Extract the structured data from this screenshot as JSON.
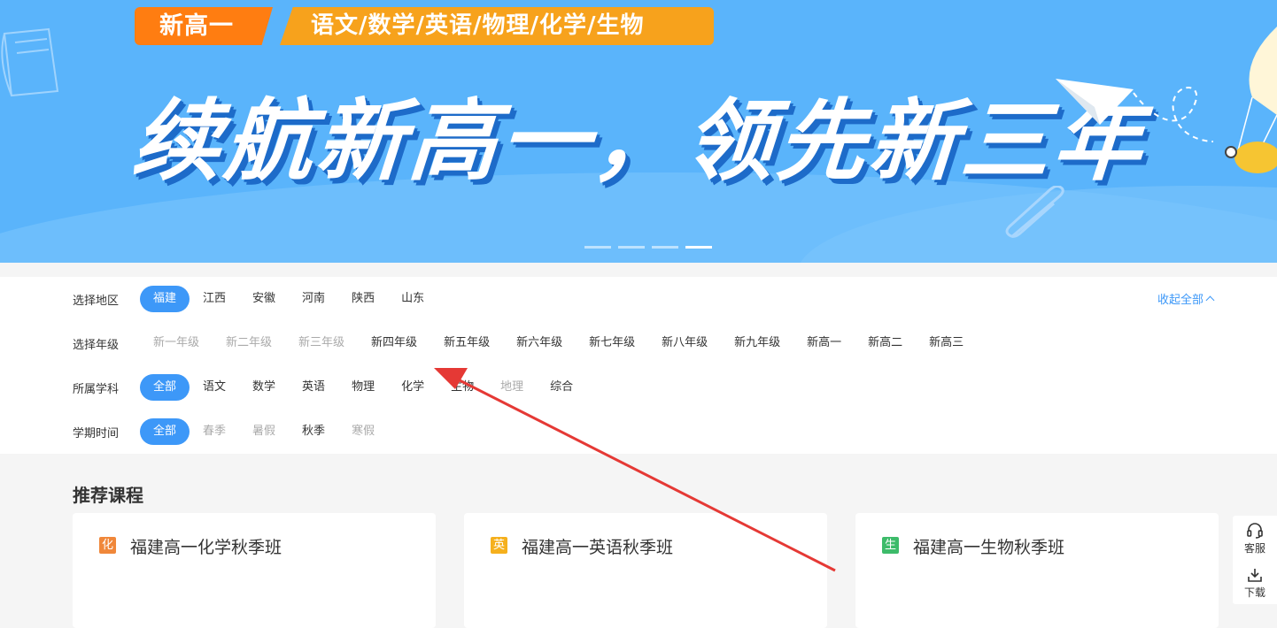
{
  "banner": {
    "tag_new": "新高一",
    "tag_subjects": "语文/数学/英语/物理/化学/生物",
    "slogan": "续航新高一，领先新三年",
    "slide_count": 4,
    "active_slide": 4
  },
  "filters": {
    "collapse_label": "收起全部",
    "region": {
      "label": "选择地区",
      "options": [
        "福建",
        "江西",
        "安徽",
        "河南",
        "陕西",
        "山东"
      ],
      "selected": "福建"
    },
    "grade": {
      "label": "选择年级",
      "options": [
        "新一年级",
        "新二年级",
        "新三年级",
        "新四年级",
        "新五年级",
        "新六年级",
        "新七年级",
        "新八年级",
        "新九年级",
        "新高一",
        "新高二",
        "新高三"
      ],
      "disabled": [
        "新一年级",
        "新二年级",
        "新三年级"
      ]
    },
    "subject": {
      "label": "所属学科",
      "options": [
        "全部",
        "语文",
        "数学",
        "英语",
        "物理",
        "化学",
        "生物",
        "地理",
        "综合"
      ],
      "selected": "全部",
      "disabled": [
        "地理"
      ]
    },
    "term": {
      "label": "学期时间",
      "options": [
        "全部",
        "春季",
        "暑假",
        "秋季",
        "寒假"
      ],
      "selected": "全部",
      "disabled": [
        "春季",
        "暑假",
        "寒假"
      ]
    }
  },
  "recommend": {
    "title": "推荐课程",
    "courses": [
      {
        "badge": "化",
        "badge_color": "#f0873a",
        "title": "福建高一化学秋季班"
      },
      {
        "badge": "英",
        "badge_color": "#f5b01d",
        "title": "福建高一英语秋季班"
      },
      {
        "badge": "生",
        "badge_color": "#3dbb6a",
        "title": "福建高一生物秋季班"
      }
    ]
  },
  "side_tools": {
    "service_label": "客服",
    "service_icon": "headset-icon",
    "download_label": "下载",
    "download_icon": "download-icon"
  },
  "colors": {
    "accent": "#3d98f8",
    "banner_bg": "#5ab4fb",
    "annotation_arrow": "#e53935"
  }
}
